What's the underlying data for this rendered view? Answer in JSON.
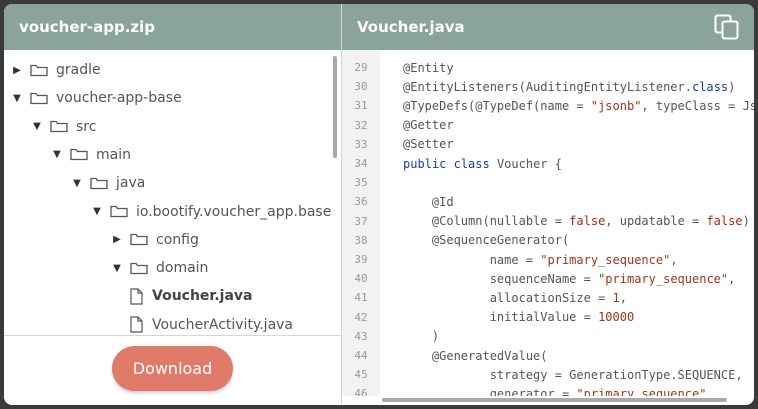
{
  "left_panel": {
    "title": "voucher-app.zip",
    "tree": [
      {
        "label": "gradle",
        "type": "folder",
        "expanded": false,
        "depth": 0
      },
      {
        "label": "voucher-app-base",
        "type": "folder",
        "expanded": true,
        "depth": 0
      },
      {
        "label": "src",
        "type": "folder",
        "expanded": true,
        "depth": 1
      },
      {
        "label": "main",
        "type": "folder",
        "expanded": true,
        "depth": 2
      },
      {
        "label": "java",
        "type": "folder",
        "expanded": true,
        "depth": 3
      },
      {
        "label": "io.bootify.voucher_app.base",
        "type": "folder",
        "expanded": true,
        "depth": 4
      },
      {
        "label": "config",
        "type": "folder",
        "expanded": false,
        "depth": 5
      },
      {
        "label": "domain",
        "type": "folder",
        "expanded": true,
        "depth": 5
      },
      {
        "label": "Voucher.java",
        "type": "file",
        "active": true,
        "depth": 6
      },
      {
        "label": "VoucherActivity.java",
        "type": "file",
        "active": false,
        "depth": 6
      }
    ],
    "download_label": "Download"
  },
  "right_panel": {
    "title": "Voucher.java",
    "copy_icon": "copy-icon",
    "lines": [
      {
        "n": "29",
        "code": "@Entity"
      },
      {
        "n": "30",
        "code": "@EntityListeners(AuditingEntityListener.class)"
      },
      {
        "n": "31",
        "code": "@TypeDefs(@TypeDef(name = \"jsonb\", typeClass = Js"
      },
      {
        "n": "32",
        "code": "@Getter"
      },
      {
        "n": "33",
        "code": "@Setter"
      },
      {
        "n": "34",
        "code": "public class Voucher {"
      },
      {
        "n": "35",
        "code": ""
      },
      {
        "n": "36",
        "code": "    @Id"
      },
      {
        "n": "37",
        "code": "    @Column(nullable = false, updatable = false)"
      },
      {
        "n": "38",
        "code": "    @SequenceGenerator("
      },
      {
        "n": "39",
        "code": "            name = \"primary_sequence\","
      },
      {
        "n": "40",
        "code": "            sequenceName = \"primary_sequence\","
      },
      {
        "n": "41",
        "code": "            allocationSize = 1,"
      },
      {
        "n": "42",
        "code": "            initialValue = 10000"
      },
      {
        "n": "43",
        "code": "    )"
      },
      {
        "n": "44",
        "code": "    @GeneratedValue("
      },
      {
        "n": "45",
        "code": "            strategy = GenerationType.SEQUENCE,"
      },
      {
        "n": "46",
        "code": "            generator = \"primary_sequence\""
      }
    ]
  },
  "colors": {
    "header_bg": "#8aa39b",
    "download_bg": "#e07b6a",
    "keyword": "#1a3e9c",
    "string": "#a0341c"
  }
}
